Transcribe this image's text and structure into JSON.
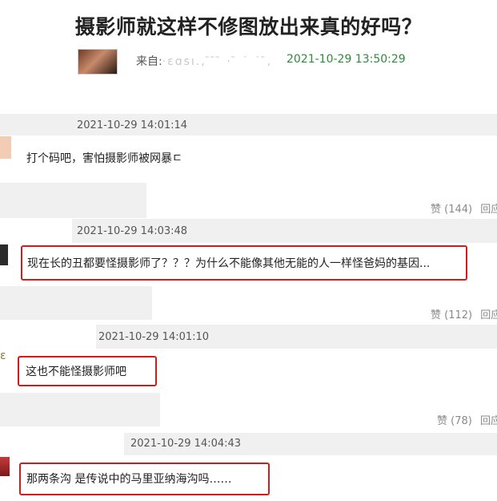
{
  "article": {
    "title": "摄影师就这样不修图放出来真的好吗？",
    "from_label": "来自:",
    "from_blurred": "·ɛɑsı.,   ̄  ̄ ̄ ·   ̄ ˙ ˙ ̄,",
    "timestamp": "2021-10-29 13:50:29"
  },
  "comments": [
    {
      "time": "2021-10-29 14:01:14",
      "text": "打个码吧，害怕摄影师被网暴ㄷ",
      "likes": "赞 (144)",
      "reply": "回应"
    },
    {
      "time": "2021-10-29 14:03:48",
      "text": "现在长的丑都要怪摄影师了？？？为什么不能像其他无能的人一样怪爸妈的基因...",
      "likes": "赞 (112)",
      "reply": "回应"
    },
    {
      "time": "2021-10-29 14:01:10",
      "text": "这也不能怪摄影师吧",
      "likes": "赞 (78)",
      "reply": "回应"
    },
    {
      "time": "2021-10-29 14:04:43",
      "text": "那两条沟 是传说中的马里亚纳海沟吗……"
    }
  ]
}
